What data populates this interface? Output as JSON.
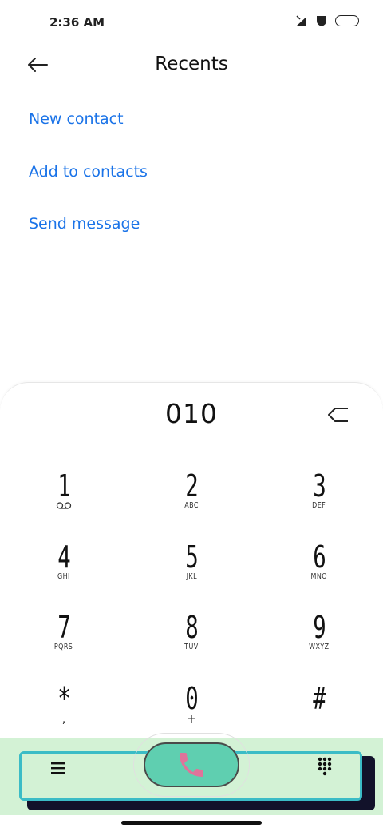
{
  "status_bar": {
    "time": "2:36 AM",
    "icons": [
      "signal-icon",
      "shield-icon",
      "battery-icon"
    ]
  },
  "header": {
    "back_icon": "arrow-left-icon",
    "title": "Recents"
  },
  "actions": [
    {
      "label": "New contact"
    },
    {
      "label": "Add to contacts"
    },
    {
      "label": "Send message"
    }
  ],
  "dialer": {
    "number": "010",
    "delete_icon": "backspace-icon",
    "keys": [
      {
        "digit": "1",
        "sub": "voicemail-icon"
      },
      {
        "digit": "2",
        "sub": "ABC"
      },
      {
        "digit": "3",
        "sub": "DEF"
      },
      {
        "digit": "4",
        "sub": "GHI"
      },
      {
        "digit": "5",
        "sub": "JKL"
      },
      {
        "digit": "6",
        "sub": "MNO"
      },
      {
        "digit": "7",
        "sub": "PQRS"
      },
      {
        "digit": "8",
        "sub": "TUV"
      },
      {
        "digit": "9",
        "sub": "WXYZ"
      },
      {
        "digit": "*",
        "sub": ","
      },
      {
        "digit": "0",
        "sub": "+"
      },
      {
        "digit": "#",
        "sub": ""
      }
    ]
  },
  "bottom_bar": {
    "menu_icon": "menu-icon",
    "call_icon": "phone-icon",
    "dialpad_icon": "dialpad-icon",
    "colors": {
      "bar_background": "#d3f2d5",
      "frame_border": "#3bbcc6",
      "call_button": "#5fcfb0",
      "phone_glyph": "#e0739a"
    }
  },
  "accent_color": "#1a73e8"
}
